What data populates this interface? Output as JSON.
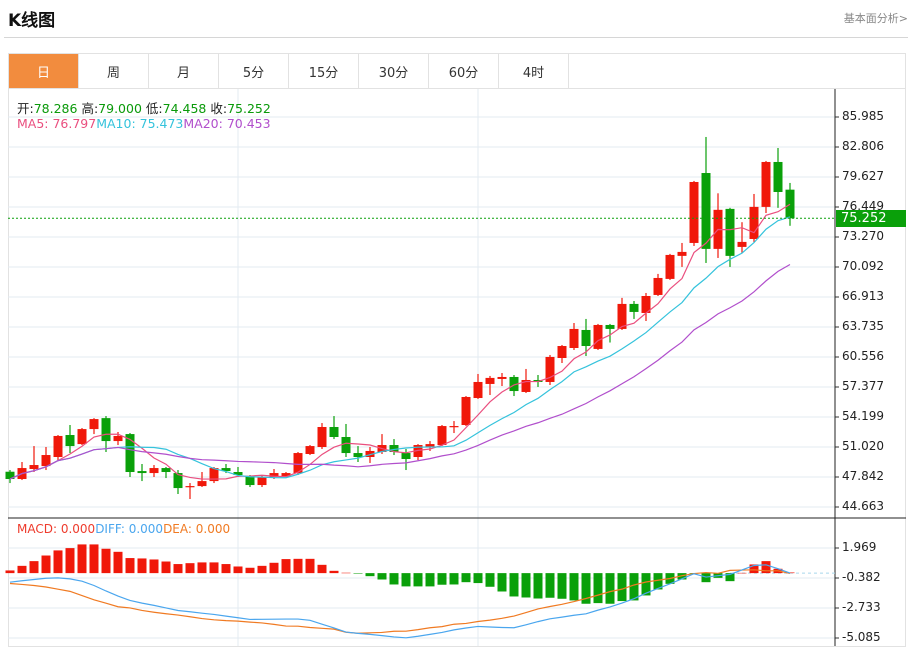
{
  "header": {
    "title": "K线图",
    "link": "基本面分析>"
  },
  "tabs": [
    {
      "label": "日",
      "active": true
    },
    {
      "label": "周"
    },
    {
      "label": "月"
    },
    {
      "label": "5分"
    },
    {
      "label": "15分"
    },
    {
      "label": "30分"
    },
    {
      "label": "60分"
    },
    {
      "label": "4时"
    }
  ],
  "info": {
    "open_label": "开:",
    "open": "78.286",
    "high_label": "高:",
    "high": "79.000",
    "low_label": "低:",
    "low": "74.458",
    "close_label": "收:",
    "close": "75.252",
    "ma5": "MA5: 76.797",
    "ma10": "MA10: 75.473",
    "ma20": "MA20: 70.453"
  },
  "macd_legend": {
    "macd": "MACD: 0.000",
    "diff": "DIFF: 0.000",
    "dea": "DEA: 0.000"
  },
  "colors": {
    "up": "#f0180a",
    "down": "#0aa00a",
    "ma5": "#ea4f7f",
    "ma10": "#35c3dc",
    "ma20": "#b14fcc",
    "diff": "#4aa6ee",
    "dea": "#f07a22",
    "accent": "#f28c3e"
  },
  "chart_data": [
    {
      "type": "candlestick",
      "price_axis": [
        "85.985",
        "82.806",
        "79.627",
        "76.449",
        "73.270",
        "70.092",
        "66.913",
        "63.735",
        "60.556",
        "57.377",
        "54.199",
        "51.020",
        "47.842",
        "44.663"
      ],
      "ylim": [
        44.663,
        85.985
      ],
      "current_price": "75.252",
      "grid": true,
      "ohlc": [
        [
          48.4,
          48.58,
          47.2,
          47.63
        ],
        [
          47.63,
          49.43,
          47.52,
          48.79
        ],
        [
          48.69,
          51.12,
          48.37,
          49.11
        ],
        [
          49.0,
          51.02,
          48.58,
          50.17
        ],
        [
          49.96,
          52.29,
          49.64,
          52.19
        ],
        [
          52.29,
          53.35,
          50.38,
          51.12
        ],
        [
          51.33,
          53.03,
          51.23,
          52.92
        ],
        [
          52.92,
          54.08,
          52.39,
          53.98
        ],
        [
          54.08,
          54.3,
          50.49,
          51.65
        ],
        [
          51.65,
          52.61,
          51.23,
          52.19
        ],
        [
          52.39,
          52.5,
          47.84,
          48.37
        ],
        [
          48.47,
          49.22,
          47.41,
          48.26
        ],
        [
          48.26,
          49.11,
          47.84,
          48.79
        ],
        [
          48.79,
          48.9,
          47.73,
          48.37
        ],
        [
          48.26,
          48.58,
          46.04,
          46.67
        ],
        [
          46.78,
          47.2,
          45.51,
          46.88
        ],
        [
          46.88,
          48.37,
          46.78,
          47.41
        ],
        [
          47.41,
          48.9,
          47.2,
          48.79
        ],
        [
          48.79,
          49.22,
          48.26,
          48.47
        ],
        [
          48.37,
          48.9,
          47.84,
          48.05
        ],
        [
          47.94,
          48.05,
          46.78,
          46.99
        ],
        [
          46.99,
          48.05,
          46.78,
          47.84
        ],
        [
          47.84,
          48.69,
          47.63,
          48.26
        ],
        [
          47.84,
          48.37,
          47.84,
          48.26
        ],
        [
          48.26,
          50.49,
          48.05,
          50.38
        ],
        [
          50.28,
          51.23,
          50.17,
          51.12
        ],
        [
          51.02,
          53.56,
          50.81,
          53.14
        ],
        [
          53.14,
          54.3,
          51.86,
          52.08
        ],
        [
          52.08,
          53.46,
          49.96,
          50.38
        ],
        [
          50.38,
          51.12,
          49.43,
          49.96
        ],
        [
          49.96,
          51.02,
          49.33,
          50.6
        ],
        [
          50.49,
          52.39,
          50.28,
          51.23
        ],
        [
          51.23,
          51.86,
          50.17,
          50.49
        ],
        [
          50.38,
          50.81,
          48.58,
          49.75
        ],
        [
          49.96,
          51.33,
          49.64,
          51.23
        ],
        [
          51.02,
          51.65,
          50.6,
          51.33
        ],
        [
          51.23,
          53.35,
          51.12,
          53.24
        ],
        [
          53.14,
          53.77,
          52.5,
          53.24
        ],
        [
          53.35,
          56.42,
          53.24,
          56.32
        ],
        [
          56.21,
          58.76,
          56.11,
          57.91
        ],
        [
          57.7,
          58.55,
          56.53,
          58.34
        ],
        [
          58.23,
          58.86,
          57.48,
          58.44
        ],
        [
          58.44,
          58.65,
          56.42,
          56.95
        ],
        [
          56.85,
          59.29,
          56.74,
          58.12
        ],
        [
          58.12,
          58.65,
          57.38,
          57.91
        ],
        [
          57.91,
          60.77,
          57.59,
          60.56
        ],
        [
          60.45,
          61.83,
          59.92,
          61.72
        ],
        [
          61.51,
          64.16,
          61.3,
          63.53
        ],
        [
          63.42,
          64.59,
          60.66,
          61.72
        ],
        [
          61.41,
          64.06,
          61.3,
          63.95
        ],
        [
          63.95,
          64.06,
          62.09,
          63.53
        ],
        [
          63.53,
          66.82,
          63.42,
          66.18
        ],
        [
          66.18,
          66.49,
          64.59,
          65.33
        ],
        [
          65.22,
          67.34,
          64.37,
          67.02
        ],
        [
          67.13,
          69.36,
          67.02,
          68.93
        ],
        [
          68.83,
          71.48,
          68.72,
          71.37
        ],
        [
          71.27,
          72.64,
          70.1,
          71.69
        ],
        [
          72.64,
          79.21,
          72.32,
          79.1
        ],
        [
          80.05,
          83.87,
          70.52,
          72.01
        ],
        [
          72.01,
          77.9,
          71.05,
          76.15
        ],
        [
          76.25,
          76.36,
          70.1,
          71.27
        ],
        [
          72.22,
          74.84,
          71.58,
          72.75
        ],
        [
          73.06,
          77.83,
          72.75,
          76.46
        ],
        [
          76.46,
          81.33,
          75.81,
          81.22
        ],
        [
          81.22,
          82.7,
          76.36,
          78.04
        ],
        [
          78.286,
          79.0,
          74.458,
          75.252
        ]
      ]
    },
    {
      "type": "macd",
      "axis": [
        "1.969",
        "-0.382",
        "-2.733",
        "-5.085"
      ],
      "ylim": [
        -5.085,
        1.969
      ],
      "macd": [
        0.21,
        0.57,
        0.94,
        1.38,
        1.78,
        1.96,
        2.25,
        2.25,
        1.91,
        1.67,
        1.18,
        1.15,
        1.07,
        0.91,
        0.71,
        0.78,
        0.84,
        0.84,
        0.71,
        0.52,
        0.42,
        0.57,
        0.81,
        1.1,
        1.12,
        1.12,
        0.65,
        0.18,
        0.03,
        -0.02,
        -0.24,
        -0.5,
        -0.89,
        -1.04,
        -1.04,
        -1.04,
        -0.91,
        -0.89,
        -0.71,
        -0.78,
        -1.07,
        -1.44,
        -1.83,
        -1.91,
        -1.99,
        -1.93,
        -2.01,
        -2.14,
        -2.4,
        -2.35,
        -2.4,
        -2.19,
        -2.14,
        -1.75,
        -1.28,
        -0.84,
        -0.5,
        -0.03,
        -0.71,
        -0.37,
        -0.63,
        0.02,
        0.68,
        0.94,
        0.34,
        0.05
      ],
      "diff": [
        -0.71,
        -0.6,
        -0.5,
        -0.4,
        -0.37,
        -0.45,
        -0.63,
        -0.97,
        -1.4,
        -1.8,
        -2.14,
        -2.35,
        -2.53,
        -2.73,
        -2.93,
        -3.03,
        -3.14,
        -3.24,
        -3.37,
        -3.5,
        -3.63,
        -3.62,
        -3.61,
        -3.6,
        -3.6,
        -3.7,
        -4.0,
        -4.3,
        -4.62,
        -4.72,
        -4.8,
        -4.9,
        -5.0,
        -5.07,
        -4.95,
        -4.8,
        -4.65,
        -4.45,
        -4.3,
        -4.18,
        -4.22,
        -4.26,
        -4.28,
        -4.05,
        -3.8,
        -3.58,
        -3.45,
        -3.3,
        -3.19,
        -2.9,
        -2.65,
        -2.35,
        -2.0,
        -1.57,
        -1.2,
        -0.84,
        -0.45,
        -0.05,
        -0.31,
        -0.2,
        -0.1,
        0.25,
        0.6,
        0.65,
        0.35,
        0.0
      ]
    }
  ]
}
